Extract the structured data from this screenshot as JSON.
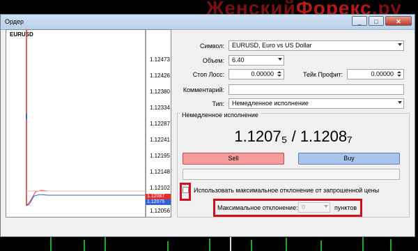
{
  "watermark": {
    "part1": "Женский",
    "part2": "Форекс",
    "part3": ".ру"
  },
  "window": {
    "title": "Ордер",
    "minimize": "_",
    "maximize": "□",
    "close": "✕"
  },
  "chart": {
    "symbol": "EURUSD",
    "price_labels": [
      "1.12473",
      "1.12426",
      "1.12380",
      "1.12334",
      "1.12287",
      "1.12241",
      "1.12195",
      "1.12148",
      "1.12102",
      "1.12087",
      "1.12075",
      "1.12056"
    ],
    "ask_tag": "1.12087",
    "bid_tag": "1.12075",
    "ask_color": "#e03030",
    "bid_color": "#3060d8"
  },
  "form": {
    "symbol_label": "Символ:",
    "symbol_value": "EURUSD, Euro vs US Dollar",
    "volume_label": "Объем:",
    "volume_value": "6.40",
    "stoploss_label": "Стоп Лосс:",
    "stoploss_value": "0.00000",
    "takeprofit_label": "Тейк Профит:",
    "takeprofit_value": "0.00000",
    "comment_label": "Комментарий:",
    "comment_value": "",
    "type_label": "Тип:",
    "type_value": "Немедленное исполнение"
  },
  "execution": {
    "group_title": "Немедленное исполнение",
    "quote": "1.1207₅ / 1.1208₇",
    "sell_label": "Sell",
    "buy_label": "Buy",
    "max_dev_checkbox_label": "Использовать максимальное отклонение от запрошенной цены",
    "max_dev_label": "Максимальное отклонение:",
    "max_dev_value": "0",
    "max_dev_unit": "пунктов"
  },
  "colors": {
    "sell": "#f29c9c",
    "buy": "#aac4ee",
    "highlight": "#d01020"
  }
}
